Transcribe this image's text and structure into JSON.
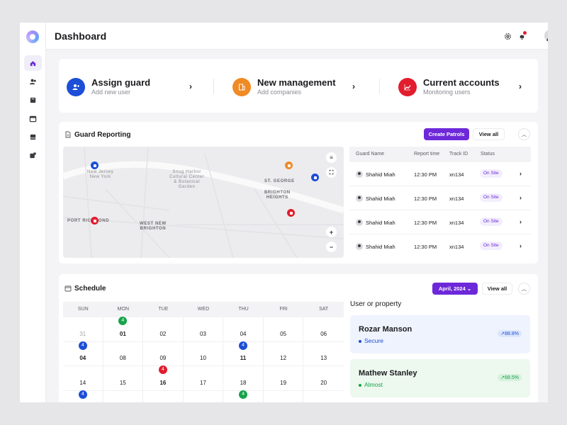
{
  "header": {
    "title": "Dashboard"
  },
  "sidebar": {
    "items": [
      "home-icon",
      "users-icon",
      "book-icon",
      "calendar-icon",
      "inbox-icon",
      "briefcase-icon"
    ]
  },
  "quick_actions": [
    {
      "title": "Assign guard",
      "subtitle": "Add new user",
      "color": "#1d4ed8",
      "icon": "user-plus-icon"
    },
    {
      "title": "New management",
      "subtitle": "Add companies",
      "color": "#f08a24",
      "icon": "building-icon"
    },
    {
      "title": "Current accounts",
      "subtitle": "Monitoring users",
      "color": "#e11d2e",
      "icon": "chart-icon"
    }
  ],
  "guard_reporting": {
    "title": "Guard Reporting",
    "create_label": "Create Patrols",
    "view_all_label": "View all",
    "map": {
      "labels": [
        "New Jersey\nNew York",
        "Snug Harbor\nCultural Center\n& Botanical\nGarden",
        "ST. GEORGE",
        "BRIGHTON\nHEIGHTS",
        "PORT RICHMOND",
        "WEST NEW\nBRIGHTON"
      ],
      "zoom_in": "+",
      "zoom_out": "−"
    },
    "columns": [
      "Guard Name",
      "Report time",
      "Track ID",
      "Status"
    ],
    "rows": [
      {
        "name": "Shahid Miah",
        "time": "12:30 PM",
        "track": "xn134",
        "status": "On Site"
      },
      {
        "name": "Shahid Miah",
        "time": "12:30 PM",
        "track": "xn134",
        "status": "On Site"
      },
      {
        "name": "Shahid Miah",
        "time": "12:30 PM",
        "track": "xn134",
        "status": "On Site"
      },
      {
        "name": "Shahid Miah",
        "time": "12:30 PM",
        "track": "xn134",
        "status": "On Site"
      }
    ]
  },
  "schedule": {
    "title": "Schedule",
    "month_label": "April, 2024",
    "view_all_label": "View all",
    "days": [
      "SUN",
      "MON",
      "TUE",
      "WED",
      "THU",
      "FRI",
      "SAT"
    ],
    "weeks": [
      [
        "31",
        "01",
        "02",
        "03",
        "04",
        "05",
        "06"
      ],
      [
        "04",
        "08",
        "09",
        "10",
        "11",
        "12",
        "13"
      ],
      [
        "14",
        "15",
        "16",
        "17",
        "18",
        "19",
        "20"
      ]
    ],
    "badges": [
      {
        "week": 0,
        "day": 1,
        "count": "4",
        "color": "#16a34a"
      },
      {
        "week": 1,
        "day": 0,
        "count": "4",
        "color": "#1d4ed8"
      },
      {
        "week": 1,
        "day": 4,
        "count": "4",
        "color": "#1d4ed8"
      },
      {
        "week": 2,
        "day": 2,
        "count": "4",
        "color": "#e11d2e"
      },
      {
        "week": 3,
        "day": 0,
        "count": "4",
        "color": "#1d4ed8"
      },
      {
        "week": 3,
        "day": 4,
        "count": "4",
        "color": "#16a34a"
      }
    ]
  },
  "user_property": {
    "title": "User or property",
    "cards": [
      {
        "name": "Rozar Manson",
        "status": "Secure",
        "pct": "↗88.8%",
        "bg": "#eef3fd",
        "color": "#1d4ed8"
      },
      {
        "name": "Mathew Stanley",
        "status": "Almost",
        "pct": "↗68.5%",
        "bg": "#edf8ef",
        "color": "#16a34a"
      }
    ]
  }
}
